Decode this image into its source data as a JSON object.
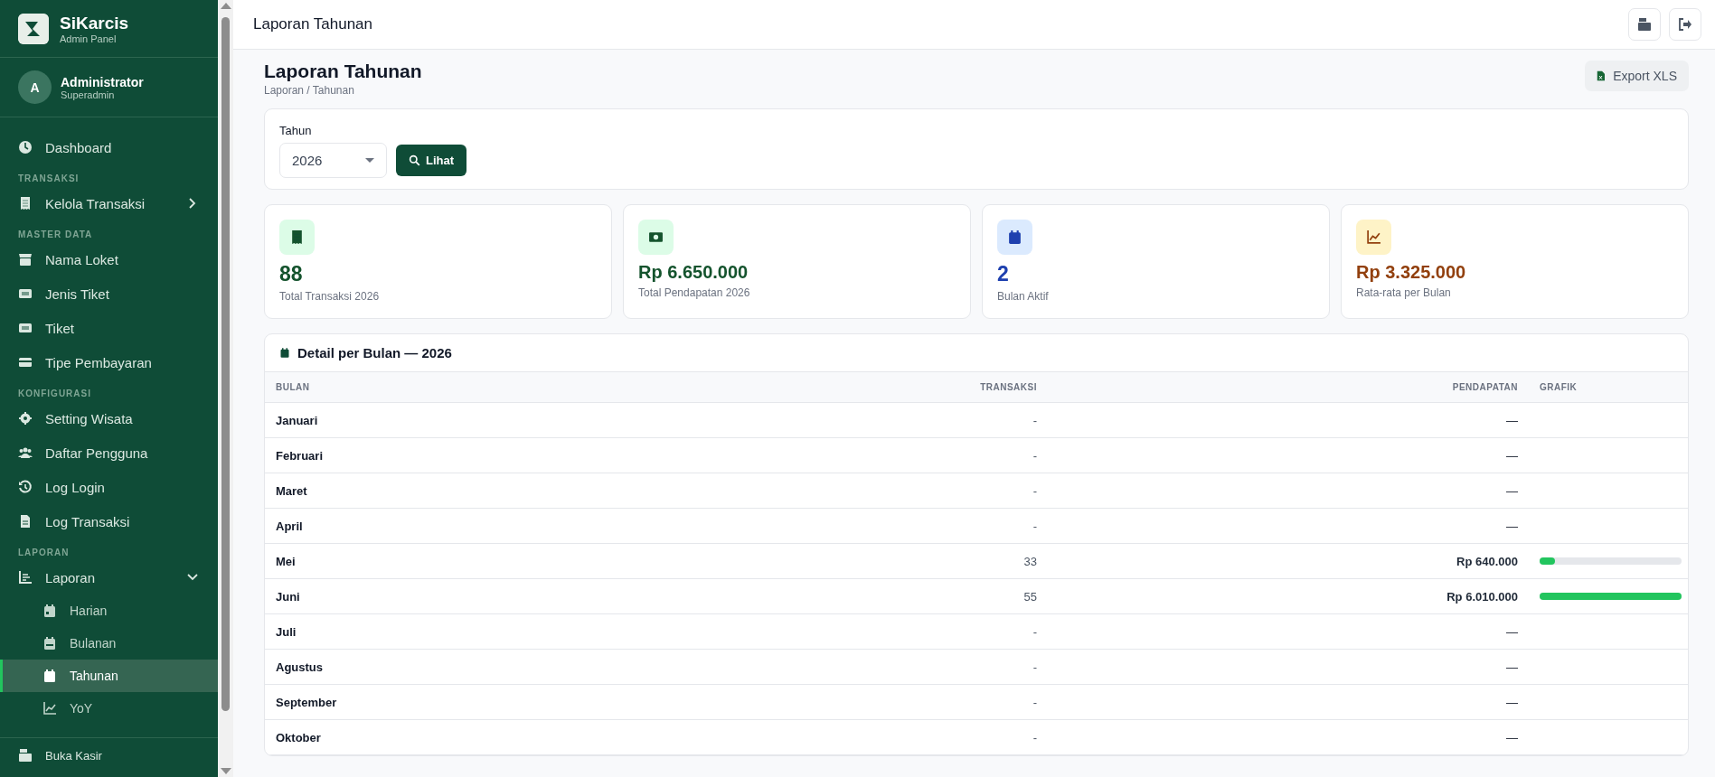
{
  "brand": {
    "name": "SiKarcis",
    "subtitle": "Admin Panel"
  },
  "user": {
    "initial": "A",
    "name": "Administrator",
    "role": "Superadmin"
  },
  "sidebar": {
    "items": [
      {
        "kind": "item",
        "label": "Dashboard",
        "selected": false
      },
      {
        "kind": "section",
        "label": "TRANSAKSI"
      },
      {
        "kind": "item",
        "label": "Kelola Transaksi",
        "selected": false,
        "expanded": false
      },
      {
        "kind": "section",
        "label": "MASTER DATA"
      },
      {
        "kind": "item",
        "label": "Nama Loket",
        "selected": false
      },
      {
        "kind": "item",
        "label": "Jenis Tiket",
        "selected": false
      },
      {
        "kind": "item",
        "label": "Tiket",
        "selected": false
      },
      {
        "kind": "item",
        "label": "Tipe Pembayaran",
        "selected": false
      },
      {
        "kind": "section",
        "label": "KONFIGURASI"
      },
      {
        "kind": "item",
        "label": "Setting Wisata",
        "selected": false
      },
      {
        "kind": "item",
        "label": "Daftar Pengguna",
        "selected": false
      },
      {
        "kind": "item",
        "label": "Log Login",
        "selected": false
      },
      {
        "kind": "item",
        "label": "Log Transaksi",
        "selected": false
      },
      {
        "kind": "section",
        "label": "LAPORAN"
      },
      {
        "kind": "item",
        "label": "Laporan",
        "selected": false,
        "expanded": true,
        "children": [
          {
            "label": "Harian",
            "selected": false
          },
          {
            "label": "Bulanan",
            "selected": false
          },
          {
            "label": "Tahunan",
            "selected": true
          },
          {
            "label": "YoY",
            "selected": false
          }
        ]
      }
    ],
    "footer_item": {
      "label": "Buka Kasir"
    }
  },
  "topbar": {
    "title": "Laporan Tahunan"
  },
  "page": {
    "title": "Laporan Tahunan",
    "breadcrumb": "Laporan / Tahunan",
    "export_button": "Export XLS"
  },
  "filter": {
    "label": "Tahun",
    "value": "2026",
    "button": "Lihat"
  },
  "stats": [
    {
      "value": "88",
      "label": "Total Transaksi 2026",
      "color": "#14532d"
    },
    {
      "value": "Rp 6.650.000",
      "label": "Total Pendapatan 2026",
      "color": "#14532d"
    },
    {
      "value": "2",
      "label": "Bulan Aktif",
      "color": "#1e40af"
    },
    {
      "value": "Rp 3.325.000",
      "label": "Rata-rata per Bulan",
      "color": "#92400e"
    }
  ],
  "table": {
    "title": "Detail per Bulan — 2026",
    "columns": [
      "BULAN",
      "TRANSAKSI",
      "PENDAPATAN",
      "GRAFIK"
    ],
    "rows": [
      {
        "bulan": "Januari",
        "transaksi": "-",
        "pendapatan": "—"
      },
      {
        "bulan": "Februari",
        "transaksi": "-",
        "pendapatan": "—"
      },
      {
        "bulan": "Maret",
        "transaksi": "-",
        "pendapatan": "—"
      },
      {
        "bulan": "April",
        "transaksi": "-",
        "pendapatan": "—"
      },
      {
        "bulan": "Mei",
        "transaksi": "33",
        "pendapatan": "Rp 640.000",
        "level": 0.106
      },
      {
        "bulan": "Juni",
        "transaksi": "55",
        "pendapatan": "Rp 6.010.000",
        "level": 1.0
      },
      {
        "bulan": "Juli",
        "transaksi": "-",
        "pendapatan": "—"
      },
      {
        "bulan": "Agustus",
        "transaksi": "-",
        "pendapatan": "—"
      },
      {
        "bulan": "September",
        "transaksi": "-",
        "pendapatan": "—"
      },
      {
        "bulan": "Oktober",
        "transaksi": "-",
        "pendapatan": "—"
      }
    ]
  }
}
